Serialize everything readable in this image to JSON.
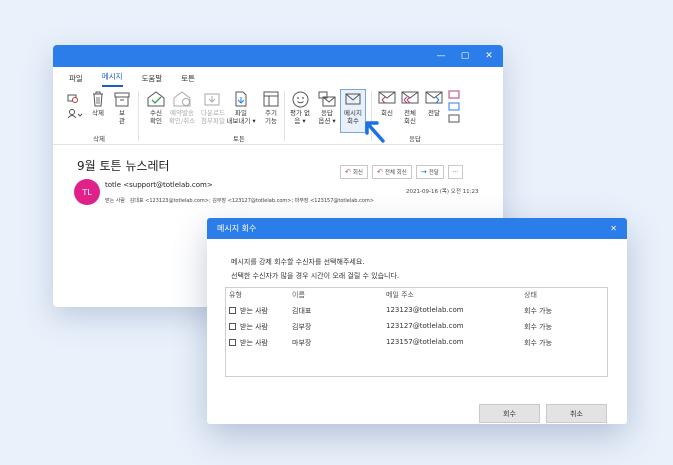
{
  "window": {
    "controls": {
      "minimize": "—",
      "maximize": "▢",
      "close": "✕"
    },
    "menus": [
      "파일",
      "메시지",
      "도움말",
      "토튼"
    ],
    "active_menu": "메시지"
  },
  "ribbon": {
    "buttons": {
      "delete": "삭제",
      "archive": "보\n관",
      "read_receipt": "수신\n확인",
      "schedule": "예약발송\n확인/취소",
      "download": "다운로드\n첨부파일",
      "export": "파일\n내보내기 ▾",
      "collect": "주기\n기능",
      "rate": "평가 없\n음 ▾",
      "reply_options": "응답\n옵션 ▾",
      "recall": "메시지\n회수",
      "reply": "회신",
      "reply_all": "전체\n회신",
      "forward": "전달"
    },
    "groups": {
      "delete": "삭제",
      "totuen": "토튼",
      "reply": "응답"
    }
  },
  "email": {
    "subject": "9월 토튼 뉴스레터",
    "reply_buttons": {
      "reply": "회신",
      "reply_all": "전체 회신",
      "forward": "전달",
      "more": "···"
    },
    "avatar_initials": "TL",
    "sender": "totle <support@totlelab.com>",
    "date": "2021-09-16 (목) 오전 11:23",
    "to_label": "받는 사람",
    "recipients": "김대표 <123123@totlelab.com>; 김부장 <123127@totlelab.com>; 마부장 <123157@totlelab.com>"
  },
  "dialog": {
    "title": "메시지 회수",
    "close": "✕",
    "instructions": [
      "메시지를 강제 회수할 수신자를 선택해주세요.",
      "선택한 수신자가 많을 경우 시간이 오래 걸릴 수 있습니다."
    ],
    "columns": {
      "type": "유형",
      "name": "이름",
      "email": "메일 주소",
      "status": "상태"
    },
    "rows": [
      {
        "type": "받는 사람",
        "name": "김대표",
        "email": "123123@totlelab.com",
        "status": "회수 가능"
      },
      {
        "type": "받는 사람",
        "name": "김부장",
        "email": "123127@totlelab.com",
        "status": "회수 가능"
      },
      {
        "type": "받는 사람",
        "name": "마부장",
        "email": "123157@totlelab.com",
        "status": "회수 가능"
      }
    ],
    "buttons": {
      "recall": "회수",
      "cancel": "취소"
    }
  },
  "colors": {
    "accent": "#2b7de9",
    "avatar": "#e0218a",
    "reply_icon": "#b0407a"
  }
}
